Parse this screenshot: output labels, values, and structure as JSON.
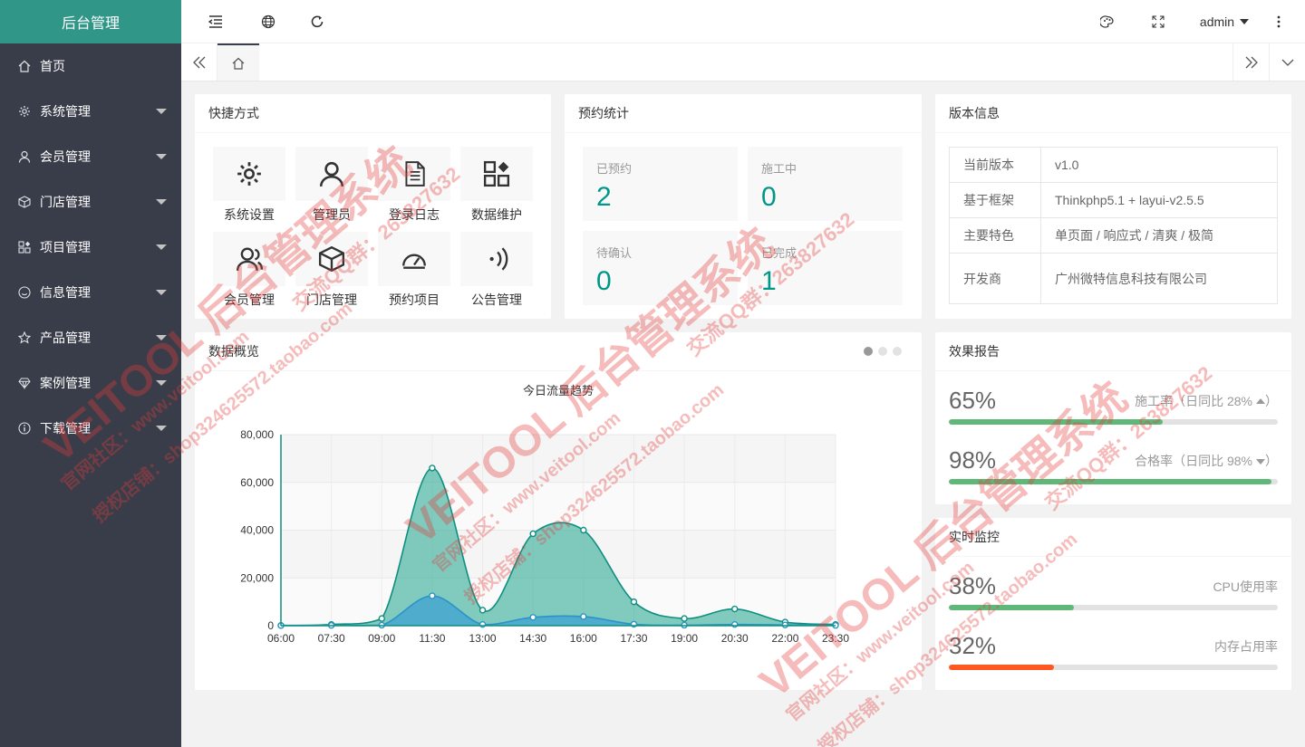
{
  "app": {
    "title": "后台管理"
  },
  "sidebar": {
    "items": [
      {
        "label": "首页",
        "icon": "home-icon",
        "has_submenu": false
      },
      {
        "label": "系统管理",
        "icon": "gear-icon",
        "has_submenu": true
      },
      {
        "label": "会员管理",
        "icon": "user-icon",
        "has_submenu": true
      },
      {
        "label": "门店管理",
        "icon": "cube-icon",
        "has_submenu": true
      },
      {
        "label": "项目管理",
        "icon": "apps-icon",
        "has_submenu": true
      },
      {
        "label": "信息管理",
        "icon": "smile-icon",
        "has_submenu": true
      },
      {
        "label": "产品管理",
        "icon": "star-icon",
        "has_submenu": true
      },
      {
        "label": "案例管理",
        "icon": "diamond-icon",
        "has_submenu": true
      },
      {
        "label": "下载管理",
        "icon": "info-icon",
        "has_submenu": true
      }
    ]
  },
  "header": {
    "user": "admin"
  },
  "shortcuts": {
    "title": "快捷方式",
    "items": [
      {
        "label": "系统设置",
        "icon": "gear-icon"
      },
      {
        "label": "管理员",
        "icon": "user-icon"
      },
      {
        "label": "登录日志",
        "icon": "log-icon"
      },
      {
        "label": "数据维护",
        "icon": "apps-icon"
      },
      {
        "label": "会员管理",
        "icon": "users-icon"
      },
      {
        "label": "门店管理",
        "icon": "cube-icon"
      },
      {
        "label": "预约项目",
        "icon": "dashboard-icon"
      },
      {
        "label": "公告管理",
        "icon": "signal-icon"
      }
    ]
  },
  "reservations": {
    "title": "预约统计",
    "stats": [
      {
        "label": "已预约",
        "value": "2"
      },
      {
        "label": "施工中",
        "value": "0"
      },
      {
        "label": "待确认",
        "value": "0"
      },
      {
        "label": "已完成",
        "value": "1"
      }
    ]
  },
  "version": {
    "title": "版本信息",
    "rows": [
      {
        "key": "当前版本",
        "value": "v1.0"
      },
      {
        "key": "基于框架",
        "value": "Thinkphp5.1 + layui-v2.5.5"
      },
      {
        "key": "主要特色",
        "value": "单页面 / 响应式 / 清爽 / 极简"
      },
      {
        "key": "开发商",
        "value": "广州微特信息科技有限公司"
      }
    ]
  },
  "overview": {
    "title": "数据概览"
  },
  "report": {
    "title": "效果报告",
    "items": [
      {
        "value": "65%",
        "desc": "施工率（日同比 28%",
        "trend": "up",
        "percent": 65,
        "color": "#5fb878"
      },
      {
        "value": "98%",
        "desc": "合格率（日同比 98%",
        "trend": "down",
        "percent": 98,
        "color": "#5fb878"
      }
    ],
    "close_paren": "）"
  },
  "monitor": {
    "title": "实时监控",
    "items": [
      {
        "value": "38%",
        "desc": "CPU使用率",
        "percent": 38,
        "color": "#5fb878"
      },
      {
        "value": "32%",
        "desc": "内存占用率",
        "percent": 32,
        "color": "#ff5722"
      }
    ]
  },
  "chart_data": {
    "type": "area",
    "title": "今日流量趋势",
    "x": [
      "06:00",
      "07:30",
      "09:00",
      "11:30",
      "13:00",
      "14:30",
      "16:00",
      "17:30",
      "19:00",
      "20:30",
      "22:00",
      "23:30"
    ],
    "ylim": [
      0,
      80000
    ],
    "yticks": [
      "0",
      "20,000",
      "40,000",
      "60,000",
      "80,000"
    ],
    "series": [
      {
        "values": [
          100,
          500,
          3000,
          66000,
          6500,
          38500,
          40000,
          10000,
          3000,
          7000,
          1500,
          500
        ],
        "color": "#2ec7c9"
      },
      {
        "values": [
          50,
          100,
          200,
          12500,
          500,
          3500,
          3800,
          600,
          200,
          500,
          300,
          100
        ],
        "color": "#5ab1ef"
      }
    ],
    "grid": true
  },
  "watermarks": [
    "VEITOOL 后台管理系统",
    "交流QQ群：263827632",
    "官网社区：www.veitool.com",
    "授权店铺：shop324625572.taobao.com"
  ]
}
